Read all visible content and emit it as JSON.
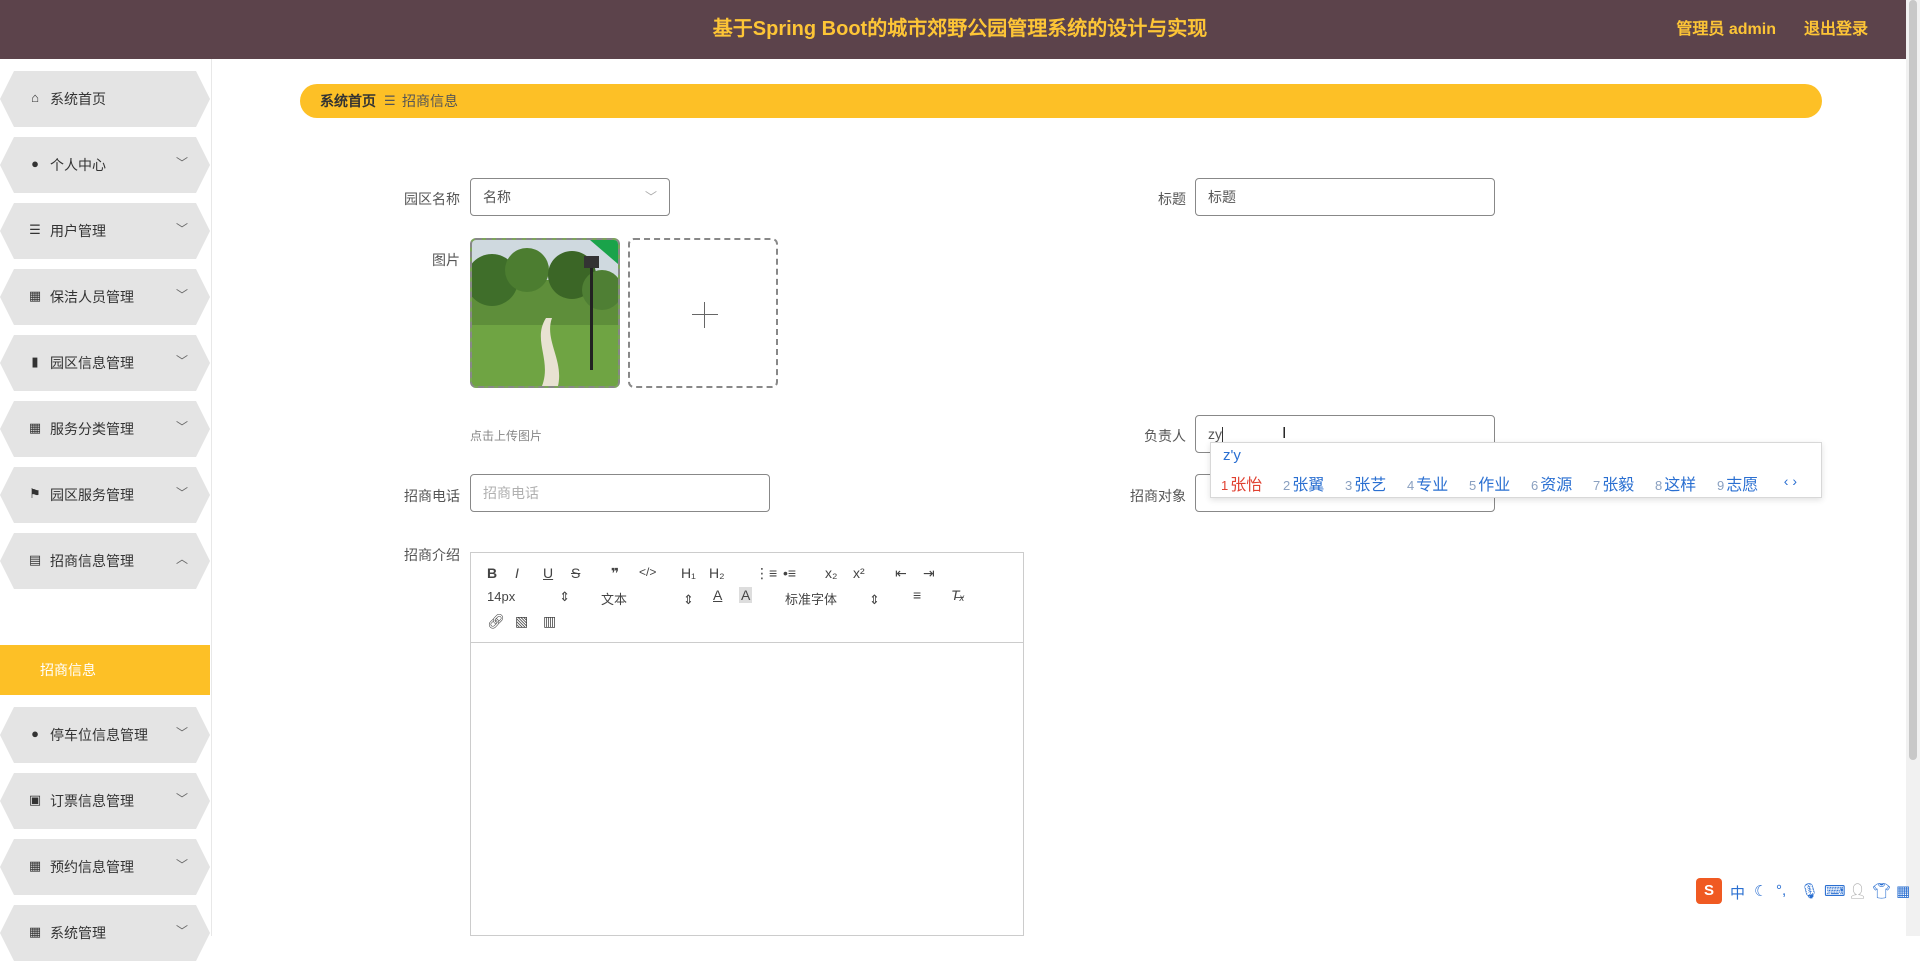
{
  "header": {
    "title": "基于Spring Boot的城市郊野公园管理系统的设计与实现",
    "user": "管理员 admin",
    "logout": "退出登录"
  },
  "sidebar": {
    "items": [
      {
        "label": "系统首页",
        "icon": "home-icon"
      },
      {
        "label": "个人中心",
        "icon": "person-icon"
      },
      {
        "label": "用户管理",
        "icon": "list-icon"
      },
      {
        "label": "保洁人员管理",
        "icon": "grid-icon"
      },
      {
        "label": "园区信息管理",
        "icon": "bar-chart-icon"
      },
      {
        "label": "服务分类管理",
        "icon": "grid-icon"
      },
      {
        "label": "园区服务管理",
        "icon": "flag-icon"
      },
      {
        "label": "招商信息管理",
        "icon": "clipboard-icon"
      },
      {
        "label": "停车位信息管理",
        "icon": "person-icon"
      },
      {
        "label": "订票信息管理",
        "icon": "clipboard-x-icon"
      },
      {
        "label": "预约信息管理",
        "icon": "grid-icon"
      },
      {
        "label": "系统管理",
        "icon": "grid-icon"
      }
    ],
    "active_sub": "招商信息"
  },
  "breadcrumb": {
    "home": "系统首页",
    "current": "招商信息"
  },
  "form": {
    "park_name": {
      "label": "园区名称",
      "value": "名称"
    },
    "title": {
      "label": "标题",
      "value": "标题"
    },
    "image": {
      "label": "图片",
      "tip": "点击上传图片"
    },
    "owner": {
      "label": "负责人",
      "value": "zy"
    },
    "phone": {
      "label": "招商电话",
      "placeholder": "招商电话"
    },
    "target": {
      "label": "招商对象"
    },
    "intro": {
      "label": "招商介绍"
    }
  },
  "editor": {
    "font_size": "14px",
    "text_style": "文本",
    "font_family": "标准字体"
  },
  "ime": {
    "pinyin": "z'y",
    "candidates": [
      "张怡",
      "张翼",
      "张艺",
      "专业",
      "作业",
      "资源",
      "张毅",
      "这样",
      "志愿"
    ]
  },
  "colors": {
    "header_bg": "#5c434b",
    "accent": "#fdc026",
    "header_text": "#fdc536"
  }
}
